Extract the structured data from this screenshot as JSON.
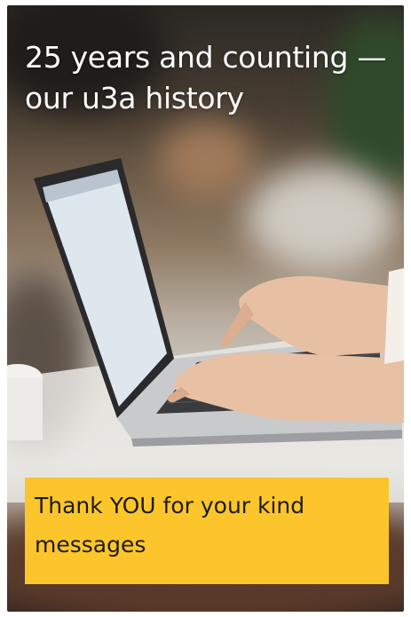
{
  "card": {
    "title": "25 years and counting — our u3a history",
    "banner_text": "Thank YOU for your kind messages"
  },
  "colors": {
    "banner": "#fcc52b",
    "title_text": "#ffffff",
    "banner_text": "#1c1c1c"
  },
  "image": {
    "subject": "laptop-typing-photo-icon"
  }
}
